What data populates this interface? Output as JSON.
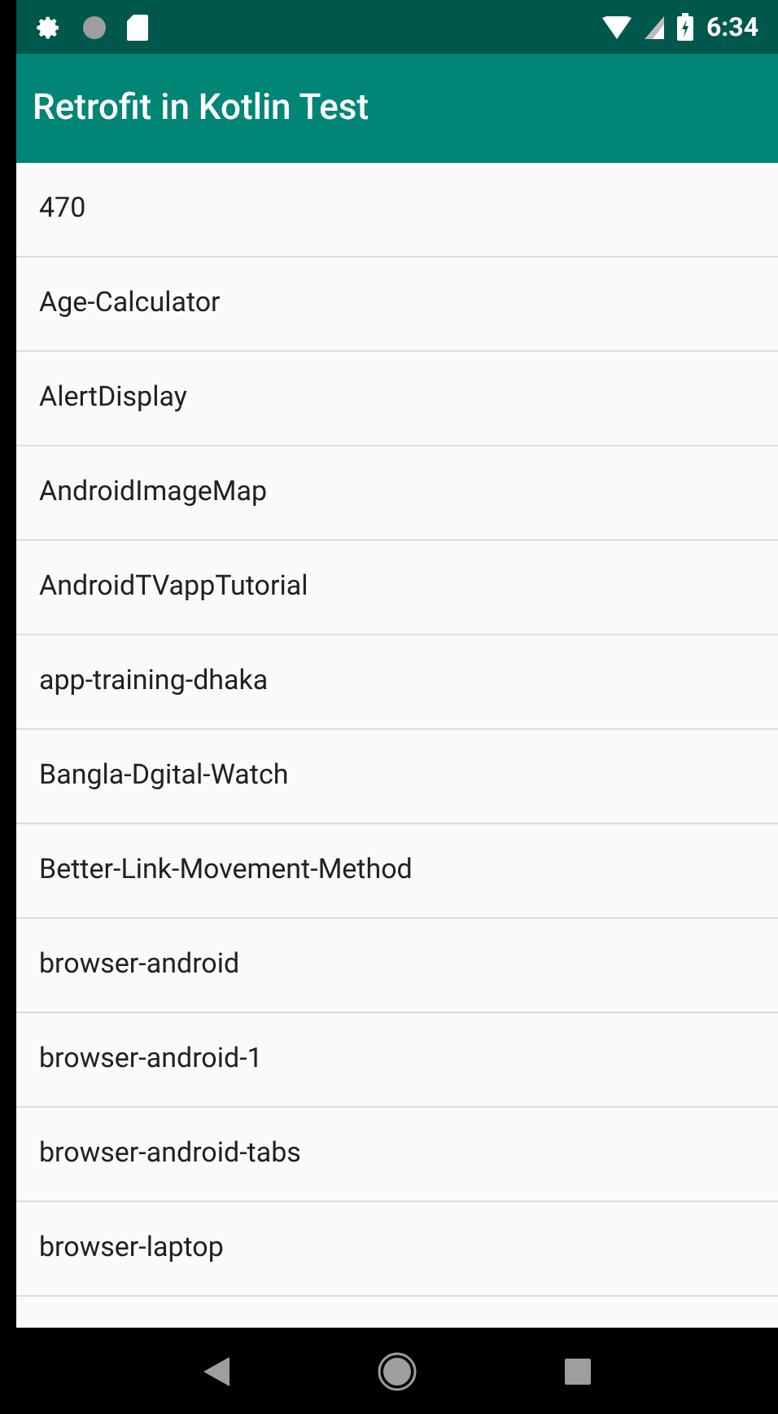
{
  "status_bar": {
    "time": "6:34"
  },
  "app_bar": {
    "title": "Retrofit in Kotlin Test"
  },
  "list": {
    "items": [
      {
        "label": "470"
      },
      {
        "label": "Age-Calculator"
      },
      {
        "label": "AlertDisplay"
      },
      {
        "label": "AndroidImageMap"
      },
      {
        "label": "AndroidTVappTutorial"
      },
      {
        "label": "app-training-dhaka"
      },
      {
        "label": "Bangla-Dgital-Watch"
      },
      {
        "label": "Better-Link-Movement-Method"
      },
      {
        "label": "browser-android"
      },
      {
        "label": "browser-android-1"
      },
      {
        "label": "browser-android-tabs"
      },
      {
        "label": "browser-laptop"
      }
    ]
  }
}
